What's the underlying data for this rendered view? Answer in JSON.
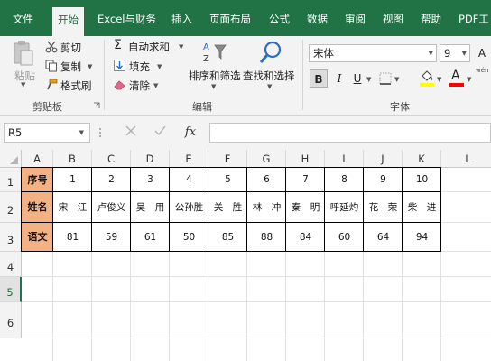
{
  "ribbon_tabs": [
    {
      "label": "文件",
      "active": false
    },
    {
      "label": "开始",
      "active": true
    },
    {
      "label": "Excel与财务",
      "active": false
    },
    {
      "label": "插入",
      "active": false
    },
    {
      "label": "页面布局",
      "active": false
    },
    {
      "label": "公式",
      "active": false
    },
    {
      "label": "数据",
      "active": false
    },
    {
      "label": "审阅",
      "active": false
    },
    {
      "label": "视图",
      "active": false
    },
    {
      "label": "帮助",
      "active": false
    },
    {
      "label": "PDF工",
      "active": false
    }
  ],
  "clipboard": {
    "paste_label": "粘贴",
    "cut_label": "剪切",
    "copy_label": "复制",
    "format_painter_label": "格式刷",
    "group_label": "剪贴板"
  },
  "editing": {
    "autosum_label": "自动求和",
    "fill_label": "填充",
    "clear_label": "清除",
    "sort_filter_label": "排序和筛选",
    "find_select_label": "查找和选择",
    "group_label": "编辑"
  },
  "font": {
    "font_name": "宋体",
    "font_size": "9",
    "bold_label": "B",
    "italic_label": "I",
    "underline_label": "U",
    "font_color_label": "A",
    "grow_label": "A",
    "shrink_label": "A",
    "wen_label": "wén",
    "group_label": "字体",
    "fill_color": "#ffff00",
    "font_color": "#ff0000"
  },
  "formula_bar": {
    "name_box": "R5",
    "fx_label": "fx",
    "cancel_icon": "x-icon",
    "enter_icon": "check-icon",
    "formula": ""
  },
  "columns": [
    "A",
    "B",
    "C",
    "D",
    "E",
    "F",
    "G",
    "H",
    "I",
    "J",
    "K",
    "L"
  ],
  "rows": [
    "1",
    "2",
    "3",
    "4",
    "5",
    "6"
  ],
  "selected_row": "5",
  "table": {
    "row1": {
      "header": "序号",
      "values": [
        "1",
        "2",
        "3",
        "4",
        "5",
        "6",
        "7",
        "8",
        "9",
        "10"
      ]
    },
    "row2": {
      "header": "姓名",
      "values": [
        "宋　江",
        "卢俊义",
        "吴　用",
        "公孙胜",
        "关　胜",
        "林　冲",
        "秦　明",
        "呼延灼",
        "花　荣",
        "柴　进"
      ]
    },
    "row3": {
      "header": "语文",
      "values": [
        "81",
        "59",
        "61",
        "50",
        "85",
        "88",
        "84",
        "60",
        "64",
        "94"
      ]
    },
    "header_fill": "#f4b183"
  },
  "colors": {
    "accent": "#217346"
  }
}
